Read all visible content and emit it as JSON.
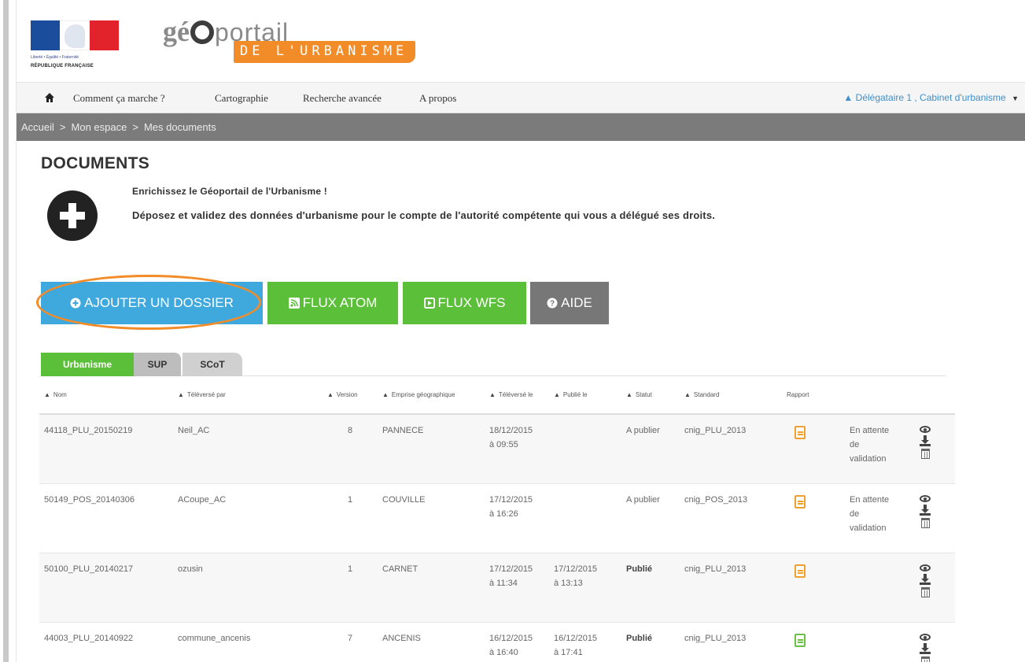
{
  "header": {
    "motto": "Liberté • Égalité • Fraternité",
    "republic": "RÉPUBLIQUE FRANÇAISE",
    "logo_ge": "gé",
    "logo_portail": "portail",
    "logo_sub": "DE L'URBANISME"
  },
  "nav": {
    "items": [
      "Comment ça marche ?",
      "Cartographie",
      "Recherche avancée",
      "A propos"
    ],
    "user": "Délégataire 1 , Cabinet d'urbanisme"
  },
  "breadcrumb": [
    "Accueil",
    "Mon espace",
    "Mes documents"
  ],
  "page": {
    "title": "DOCUMENTS",
    "intro_title": "Enrichissez le Géoportail de l'Urbanisme !",
    "intro_text": "Déposez et validez des données d'urbanisme pour le compte de l'autorité compétente qui vous a délégué ses droits."
  },
  "buttons": {
    "add": "AJOUTER UN DOSSIER",
    "atom": "FLUX ATOM",
    "wfs": "FLUX WFS",
    "aide": "AIDE"
  },
  "tabs": [
    "Urbanisme",
    "SUP",
    "SCoT"
  ],
  "table": {
    "headers": [
      "Nom",
      "Téléversé par",
      "Version",
      "Emprise géographique",
      "Téléversé le",
      "Publié le",
      "Statut",
      "Standard",
      "Rapport"
    ],
    "rows": [
      {
        "nom": "44118_PLU_20150219",
        "par": "Neil_AC",
        "version": "8",
        "emprise": "PANNECE",
        "televerse_date": "18/12/2015",
        "televerse_heure": "à 09:55",
        "publie_date": "",
        "publie_heure": "",
        "statut": "A publier",
        "standard": "cnig_PLU_2013",
        "report": "orange",
        "etat": [
          "En attente",
          "de",
          "validation"
        ]
      },
      {
        "nom": "50149_POS_20140306",
        "par": "ACoupe_AC",
        "version": "1",
        "emprise": "COUVILLE",
        "televerse_date": "17/12/2015",
        "televerse_heure": "à 16:26",
        "publie_date": "",
        "publie_heure": "",
        "statut": "A publier",
        "standard": "cnig_POS_2013",
        "report": "orange",
        "etat": [
          "En attente",
          "de",
          "validation"
        ]
      },
      {
        "nom": "50100_PLU_20140217",
        "par": "ozusin",
        "version": "1",
        "emprise": "CARNET",
        "televerse_date": "17/12/2015",
        "televerse_heure": "à 11:34",
        "publie_date": "17/12/2015",
        "publie_heure": "à 13:13",
        "statut": "Publié",
        "standard": "cnig_PLU_2013",
        "report": "orange",
        "etat": [
          "",
          "",
          ""
        ]
      },
      {
        "nom": "44003_PLU_20140922",
        "par": "commune_ancenis",
        "version": "7",
        "emprise": "ANCENIS",
        "televerse_date": "16/12/2015",
        "televerse_heure": "à 16:40",
        "publie_date": "16/12/2015",
        "publie_heure": "à 17:41",
        "statut": "Publié",
        "standard": "cnig_PLU_2013",
        "report": "green",
        "etat": [
          "",
          "",
          ""
        ]
      }
    ]
  },
  "colors": {
    "accent_blue": "#3fa9de",
    "accent_green": "#5cbf3a",
    "accent_orange": "#f28c28",
    "breadcrumb_bg": "#7b7b7b"
  }
}
